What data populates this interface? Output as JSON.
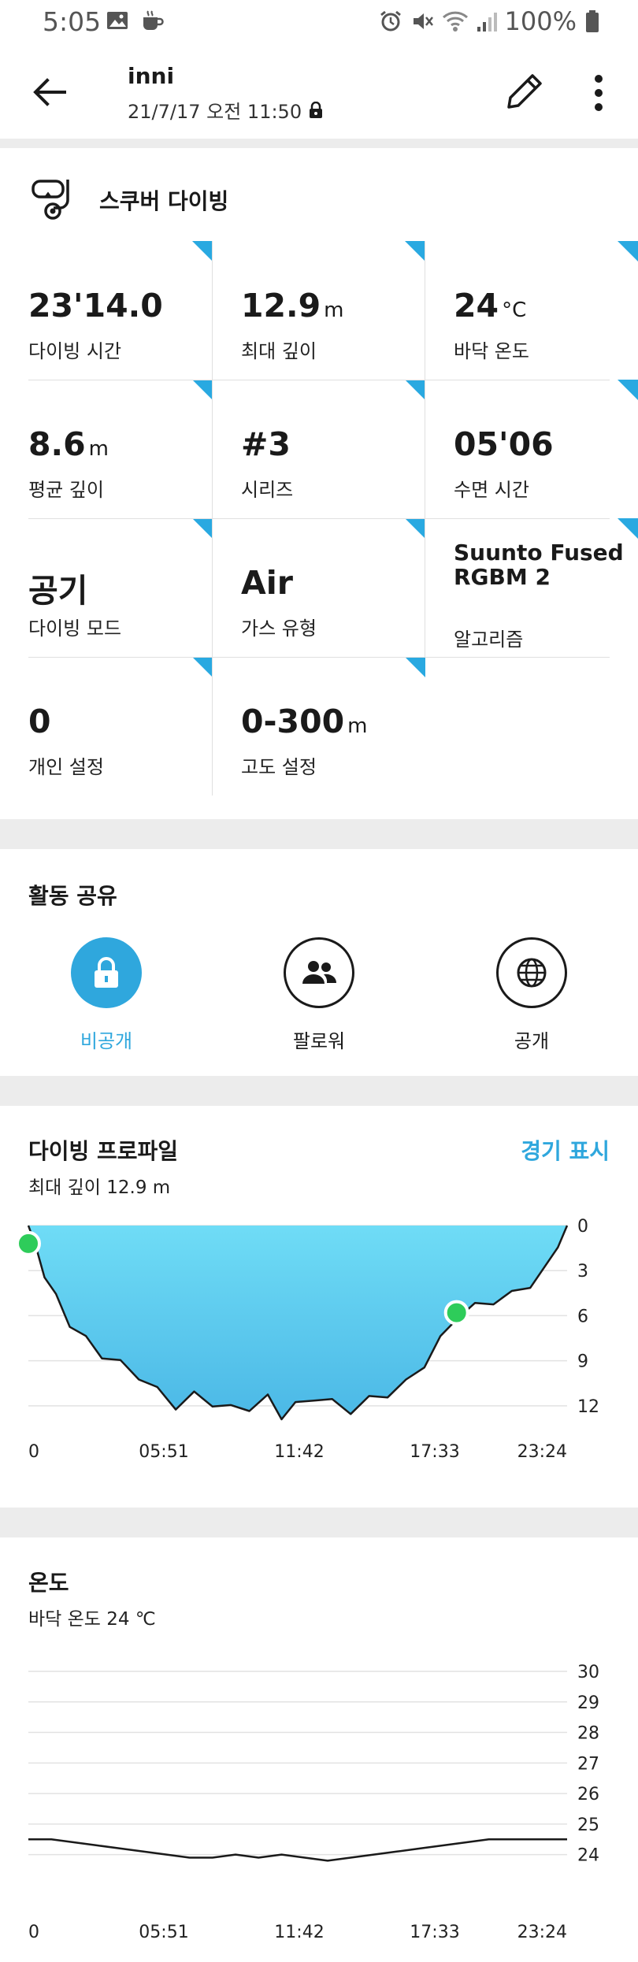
{
  "status_bar": {
    "time": "5:05",
    "battery": "100%"
  },
  "app_bar": {
    "title": "inni",
    "subtitle": "21/7/17 오전 11:50"
  },
  "activity": {
    "name": "스쿠버 다이빙",
    "stats": [
      {
        "value": "23'14.0",
        "unit": "",
        "label": "다이빙 시간"
      },
      {
        "value": "12.9",
        "unit": "m",
        "label": "최대 깊이"
      },
      {
        "value": "24",
        "unit": "°C",
        "label": "바닥 온도"
      },
      {
        "value": "8.6",
        "unit": "m",
        "label": "평균 깊이"
      },
      {
        "value": "#3",
        "unit": "",
        "label": "시리즈"
      },
      {
        "value": "05'06",
        "unit": "",
        "label": "수면 시간"
      },
      {
        "value": "공기",
        "unit": "",
        "label": "다이빙 모드"
      },
      {
        "value": "Air",
        "unit": "",
        "label": "가스 유형"
      },
      {
        "value": "Suunto Fused RGBM 2",
        "unit": "",
        "label": "알고리즘"
      },
      {
        "value": "0",
        "unit": "",
        "label": "개인 설정"
      },
      {
        "value": "0-300",
        "unit": "m",
        "label": "고도 설정"
      }
    ]
  },
  "share": {
    "title": "활동 공유",
    "options": [
      {
        "label": "비공개",
        "icon": "lock-icon",
        "selected": true
      },
      {
        "label": "팔로워",
        "icon": "followers-icon",
        "selected": false
      },
      {
        "label": "공개",
        "icon": "globe-icon",
        "selected": false
      }
    ],
    "accent_color": "#2fa7dd"
  },
  "dive_profile": {
    "title": "다이빙 프로파일",
    "subtitle": "최대 깊이 12.9 m",
    "link": "경기 표시"
  },
  "temperature": {
    "title": "온도",
    "subtitle": "바닥 온도 24 ℃"
  },
  "chart_data": [
    {
      "type": "area",
      "name": "dive-profile",
      "x_ticks": [
        "0",
        "05:51",
        "11:42",
        "17:33",
        "23:24"
      ],
      "y_ticks": [
        "0",
        "3",
        "6",
        "9",
        "12"
      ],
      "ylim": [
        0,
        12.9
      ],
      "y_inverted": true,
      "x_minutes": [
        0,
        0.3,
        0.7,
        1.2,
        1.8,
        2.5,
        3.2,
        4.0,
        4.8,
        5.6,
        6.4,
        7.2,
        8.0,
        8.8,
        9.6,
        10.4,
        11.0,
        11.6,
        12.4,
        13.2,
        14.0,
        14.8,
        15.6,
        16.4,
        17.2,
        17.9,
        18.6,
        19.4,
        20.2,
        21.0,
        21.8,
        22.6,
        23.0,
        23.4
      ],
      "depth_m": [
        0,
        1.5,
        3.2,
        4.8,
        6.5,
        7.6,
        8.6,
        9.2,
        10.0,
        11.0,
        12.0,
        11.3,
        11.8,
        12.2,
        12.1,
        11.5,
        12.9,
        12.0,
        11.4,
        11.8,
        12.3,
        11.6,
        11.2,
        10.5,
        9.2,
        7.6,
        6.0,
        5.4,
        5.0,
        4.6,
        3.9,
        2.6,
        1.2,
        0
      ],
      "markers": [
        {
          "x_minutes": 0,
          "depth_m": 1.2
        },
        {
          "x_minutes": 18.6,
          "depth_m": 5.8
        }
      ],
      "fill_color": "#5fd0f0",
      "line_color": "#1a1a1a",
      "marker_color": "#2ecc5a"
    },
    {
      "type": "line",
      "name": "temperature",
      "x_ticks": [
        "0",
        "05:51",
        "11:42",
        "17:33",
        "23:24"
      ],
      "y_ticks": [
        "30",
        "29",
        "28",
        "27",
        "26",
        "25",
        "24"
      ],
      "ylim": [
        23.5,
        30
      ],
      "x_minutes": [
        0,
        1.0,
        2.0,
        3.0,
        4.0,
        5.0,
        6.0,
        7.0,
        8.0,
        9.0,
        10.0,
        11.0,
        12.0,
        13.0,
        14.0,
        15.0,
        16.0,
        17.0,
        18.0,
        19.0,
        20.0,
        21.0,
        22.0,
        23.4
      ],
      "temp_c": [
        24.5,
        24.5,
        24.4,
        24.3,
        24.2,
        24.1,
        24.0,
        23.9,
        23.9,
        24.0,
        23.9,
        24.0,
        23.9,
        23.8,
        23.9,
        24.0,
        24.1,
        24.2,
        24.3,
        24.4,
        24.5,
        24.5,
        24.5,
        24.5
      ],
      "line_color": "#1a1a1a"
    }
  ]
}
